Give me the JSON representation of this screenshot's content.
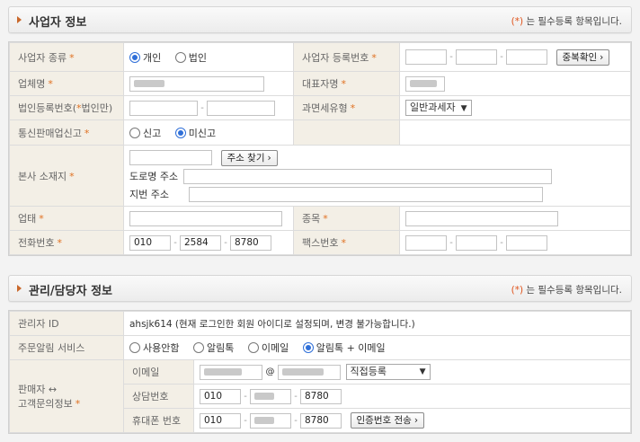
{
  "section1": {
    "title": "사업자 정보",
    "note_ast": "(*)",
    "note_text": " 는 필수등록 항목입니다.",
    "fields": {
      "biz_type_label": "사업자 종류",
      "biz_type_options": [
        "개인",
        "법인"
      ],
      "biz_type_selected": "개인",
      "biz_reg_no_label": "사업자 등록번호",
      "dup_check_button": "중복확인",
      "company_label": "업체명",
      "rep_label": "대표자명",
      "corp_reg_label": "법인등록번호(",
      "corp_reg_label_ast": "*",
      "corp_reg_label_tail": "법인만)",
      "tax_type_label": "과면세유형",
      "tax_type_value": "일반과세자",
      "telesales_label": "통신판매업신고",
      "telesales_options": [
        "신고",
        "미신고"
      ],
      "telesales_selected": "미신고",
      "hq_address_label": "본사 소재지",
      "find_address_button": "주소 찾기",
      "road_address_label": "도로명 주소",
      "lot_address_label": "지번 주소",
      "business_label": "업태",
      "category_label": "종목",
      "phone_label": "전화번호",
      "phone_parts": [
        "010",
        "2584",
        "8780"
      ],
      "fax_label": "팩스번호"
    }
  },
  "section2": {
    "title": "관리/담당자 정보",
    "note_ast": "(*)",
    "note_text": " 는 필수등록 항목입니다.",
    "fields": {
      "admin_id_label": "관리자 ID",
      "admin_id_value": "ahsjk614 (현재 로그인한 회원 아이디로 설정되며, 변경 불가능합니다.)",
      "order_alert_label": "주문알림 서비스",
      "order_alert_options": [
        "사용안함",
        "알림톡",
        "이메일",
        "알림톡 + 이메일"
      ],
      "order_alert_selected": "알림톡 + 이메일",
      "seller_contact_label_1": "판매자 ↔",
      "seller_contact_label_2": "고객문의정보",
      "email_label": "이메일",
      "email_at": "@",
      "email_domain_select": "직접등록",
      "consult_label": "상담번호",
      "consult_parts": [
        "010",
        "",
        "8780"
      ],
      "mobile_label": "휴대폰 번호",
      "mobile_parts": [
        "010",
        "",
        "8780"
      ],
      "send_code_button": "인증번호 전송"
    }
  },
  "colors": {
    "label_bg": "#f3efe6",
    "required": "#e07020",
    "accent_triangle": "#c9682b",
    "radio_on": "#2f6fd8"
  }
}
